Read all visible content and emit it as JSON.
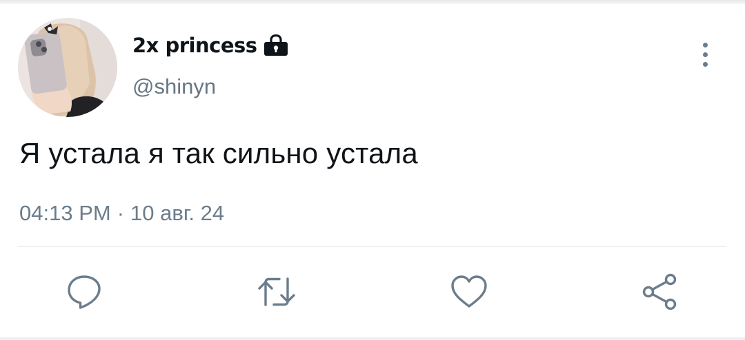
{
  "tweet": {
    "author": {
      "display_name": "2x princess",
      "handle": "@shinyn",
      "avatar_icon": "avatar-photo",
      "protected_icon": "lock-icon"
    },
    "text": "Я устала я так сильно устала",
    "time": "04:13 PM",
    "separator": "·",
    "date": "10 авг. 24"
  },
  "actions": [
    {
      "icon": "reply-icon"
    },
    {
      "icon": "retweet-icon"
    },
    {
      "icon": "like-icon"
    },
    {
      "icon": "share-icon"
    }
  ],
  "colors": {
    "text_primary": "#0f1419",
    "text_secondary": "#687684",
    "icon_gray": "#6b7d8c",
    "divider": "#e6e9ec",
    "background": "#ffffff"
  }
}
